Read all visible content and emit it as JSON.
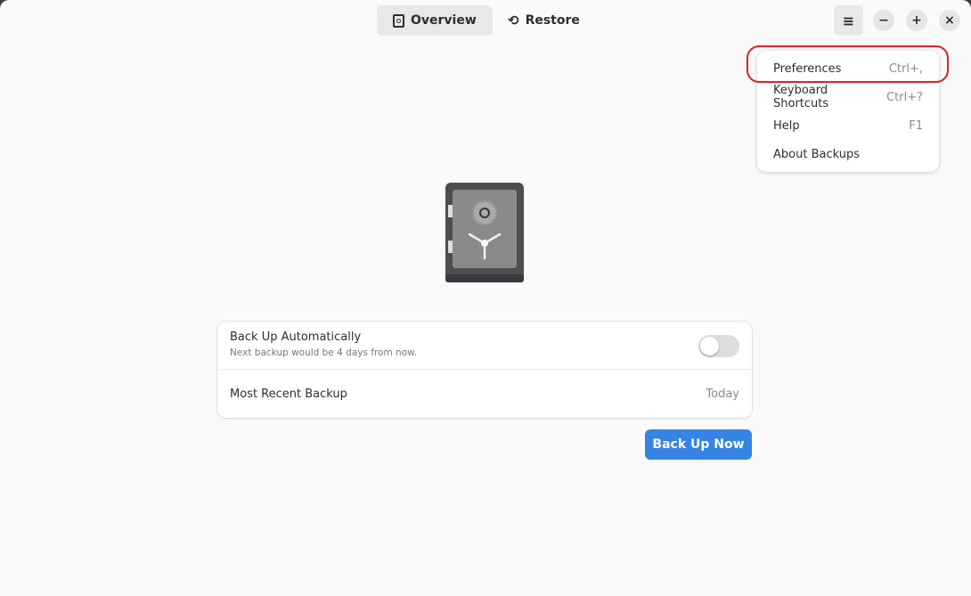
{
  "header": {
    "tabs": [
      {
        "label": "Overview",
        "icon": "safe-icon",
        "active": true
      },
      {
        "label": "Restore",
        "icon": "history-icon",
        "active": false
      }
    ],
    "menu_icon": "hamburger-icon",
    "minimize": "−",
    "maximize": "+",
    "close": "×"
  },
  "menu": {
    "items": [
      {
        "label": "Preferences",
        "accel": "Ctrl+,",
        "highlighted": true
      },
      {
        "label": "Keyboard Shortcuts",
        "accel": "Ctrl+?"
      },
      {
        "label": "Help",
        "accel": "F1"
      },
      {
        "label": "About Backups",
        "accel": ""
      }
    ]
  },
  "main": {
    "auto": {
      "title": "Back Up Automatically",
      "subtitle": "Next backup would be 4 days from now.",
      "enabled": false
    },
    "recent": {
      "label": "Most Recent Backup",
      "value": "Today"
    },
    "backup_button": "Back Up Now"
  },
  "colors": {
    "accent": "#3584e4",
    "highlight": "#d9202a"
  }
}
